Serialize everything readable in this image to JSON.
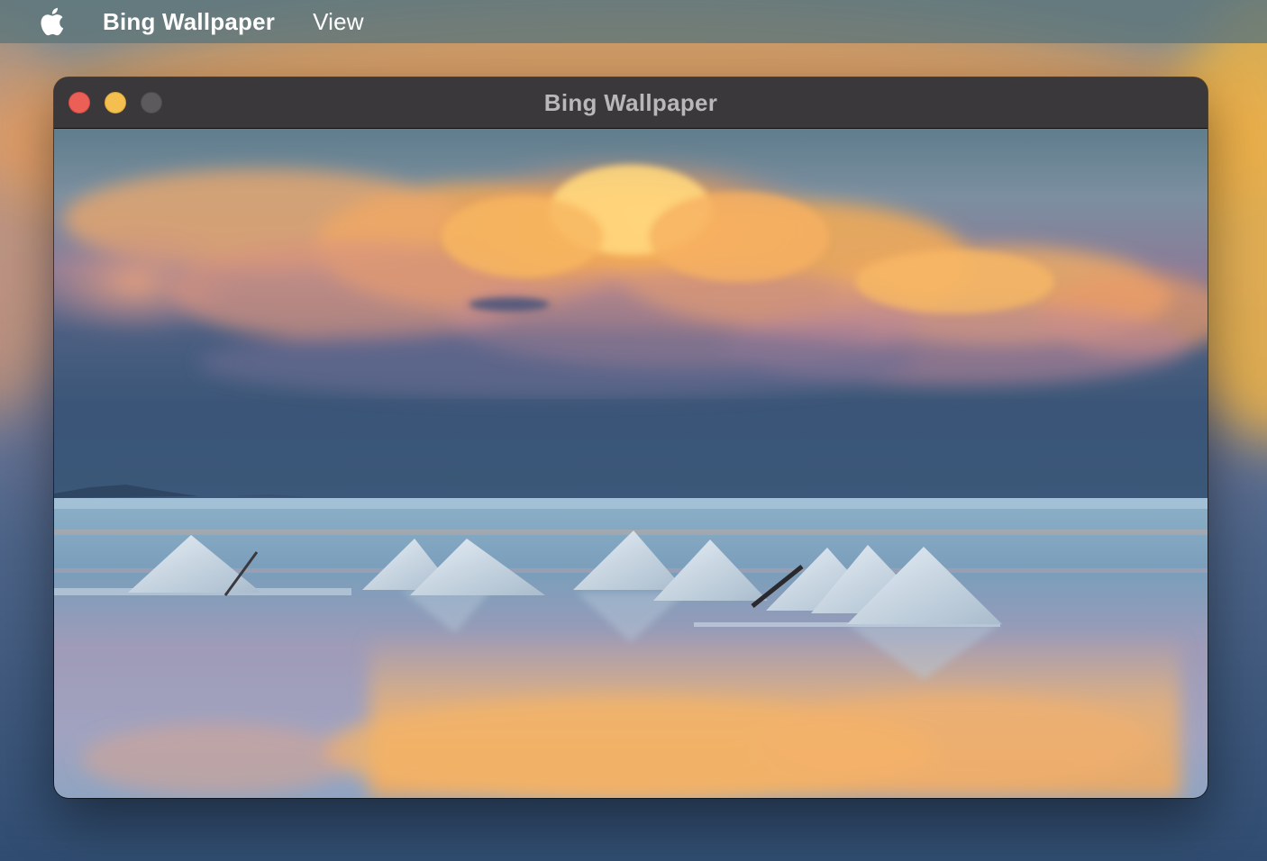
{
  "menubar": {
    "apple_icon": "apple-logo-icon",
    "app_name": "Bing Wallpaper",
    "items": [
      {
        "label": "View"
      }
    ]
  },
  "window": {
    "title": "Bing Wallpaper",
    "controls": {
      "close": "close-button",
      "minimize": "minimize-button",
      "zoom": "zoom-button"
    }
  },
  "wallpaper": {
    "subject": "Salt piles on reflective salt flat under orange sunset clouds"
  },
  "colors": {
    "menubar_bg": "#60767a",
    "titlebar_bg": "#3a383a",
    "close": "#ec5f57",
    "minimize": "#f4bf4f",
    "zoom_disabled": "#5c5a5c",
    "cloud_orange": "#f6a94a",
    "sky_blue": "#5f7d8f",
    "water_blue": "#7fa4bd"
  }
}
